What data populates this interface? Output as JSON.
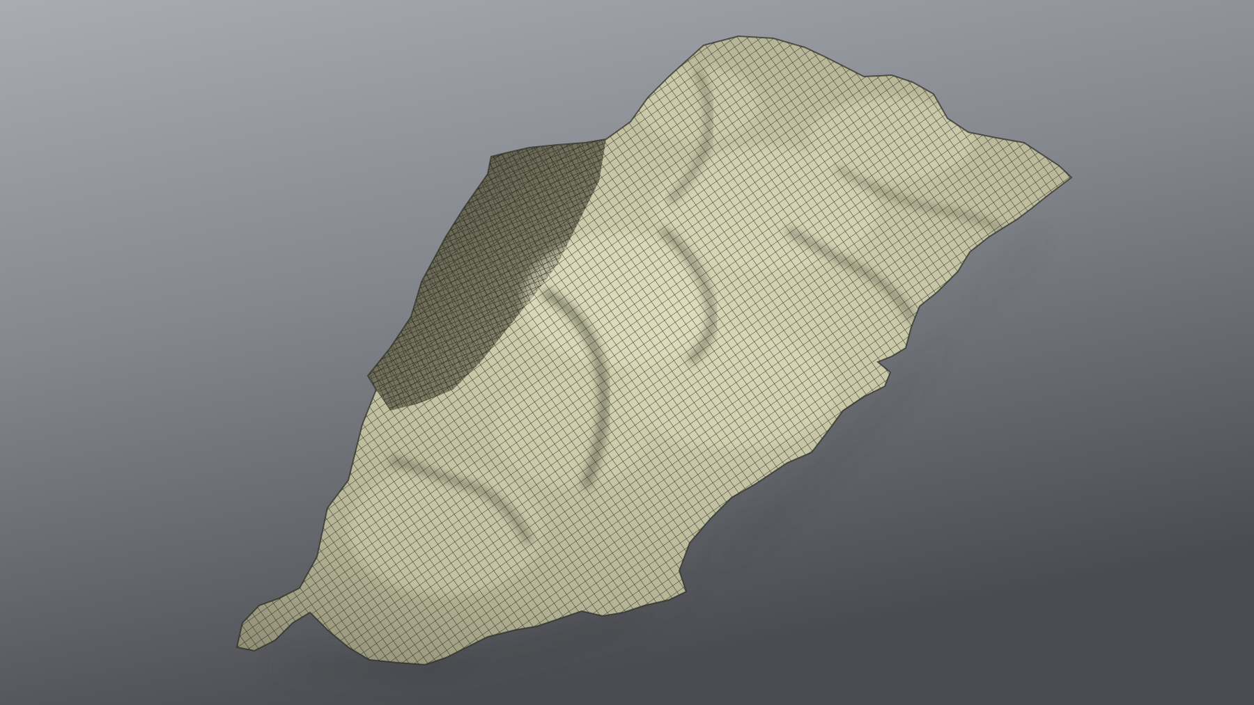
{
  "scene": {
    "subject": "rock-outcrop-wireframe-mesh",
    "colors": {
      "background_top": "#a9acb3",
      "background_mid": "#84878d",
      "background_bottom": "#4a4c51",
      "mesh_light": "#d8d7b5",
      "mesh_mid": "#b7b597",
      "mesh_dark": "#6d6c57",
      "wire": "#1e1f18",
      "shadow": "#3a3b3e"
    },
    "icons": []
  }
}
